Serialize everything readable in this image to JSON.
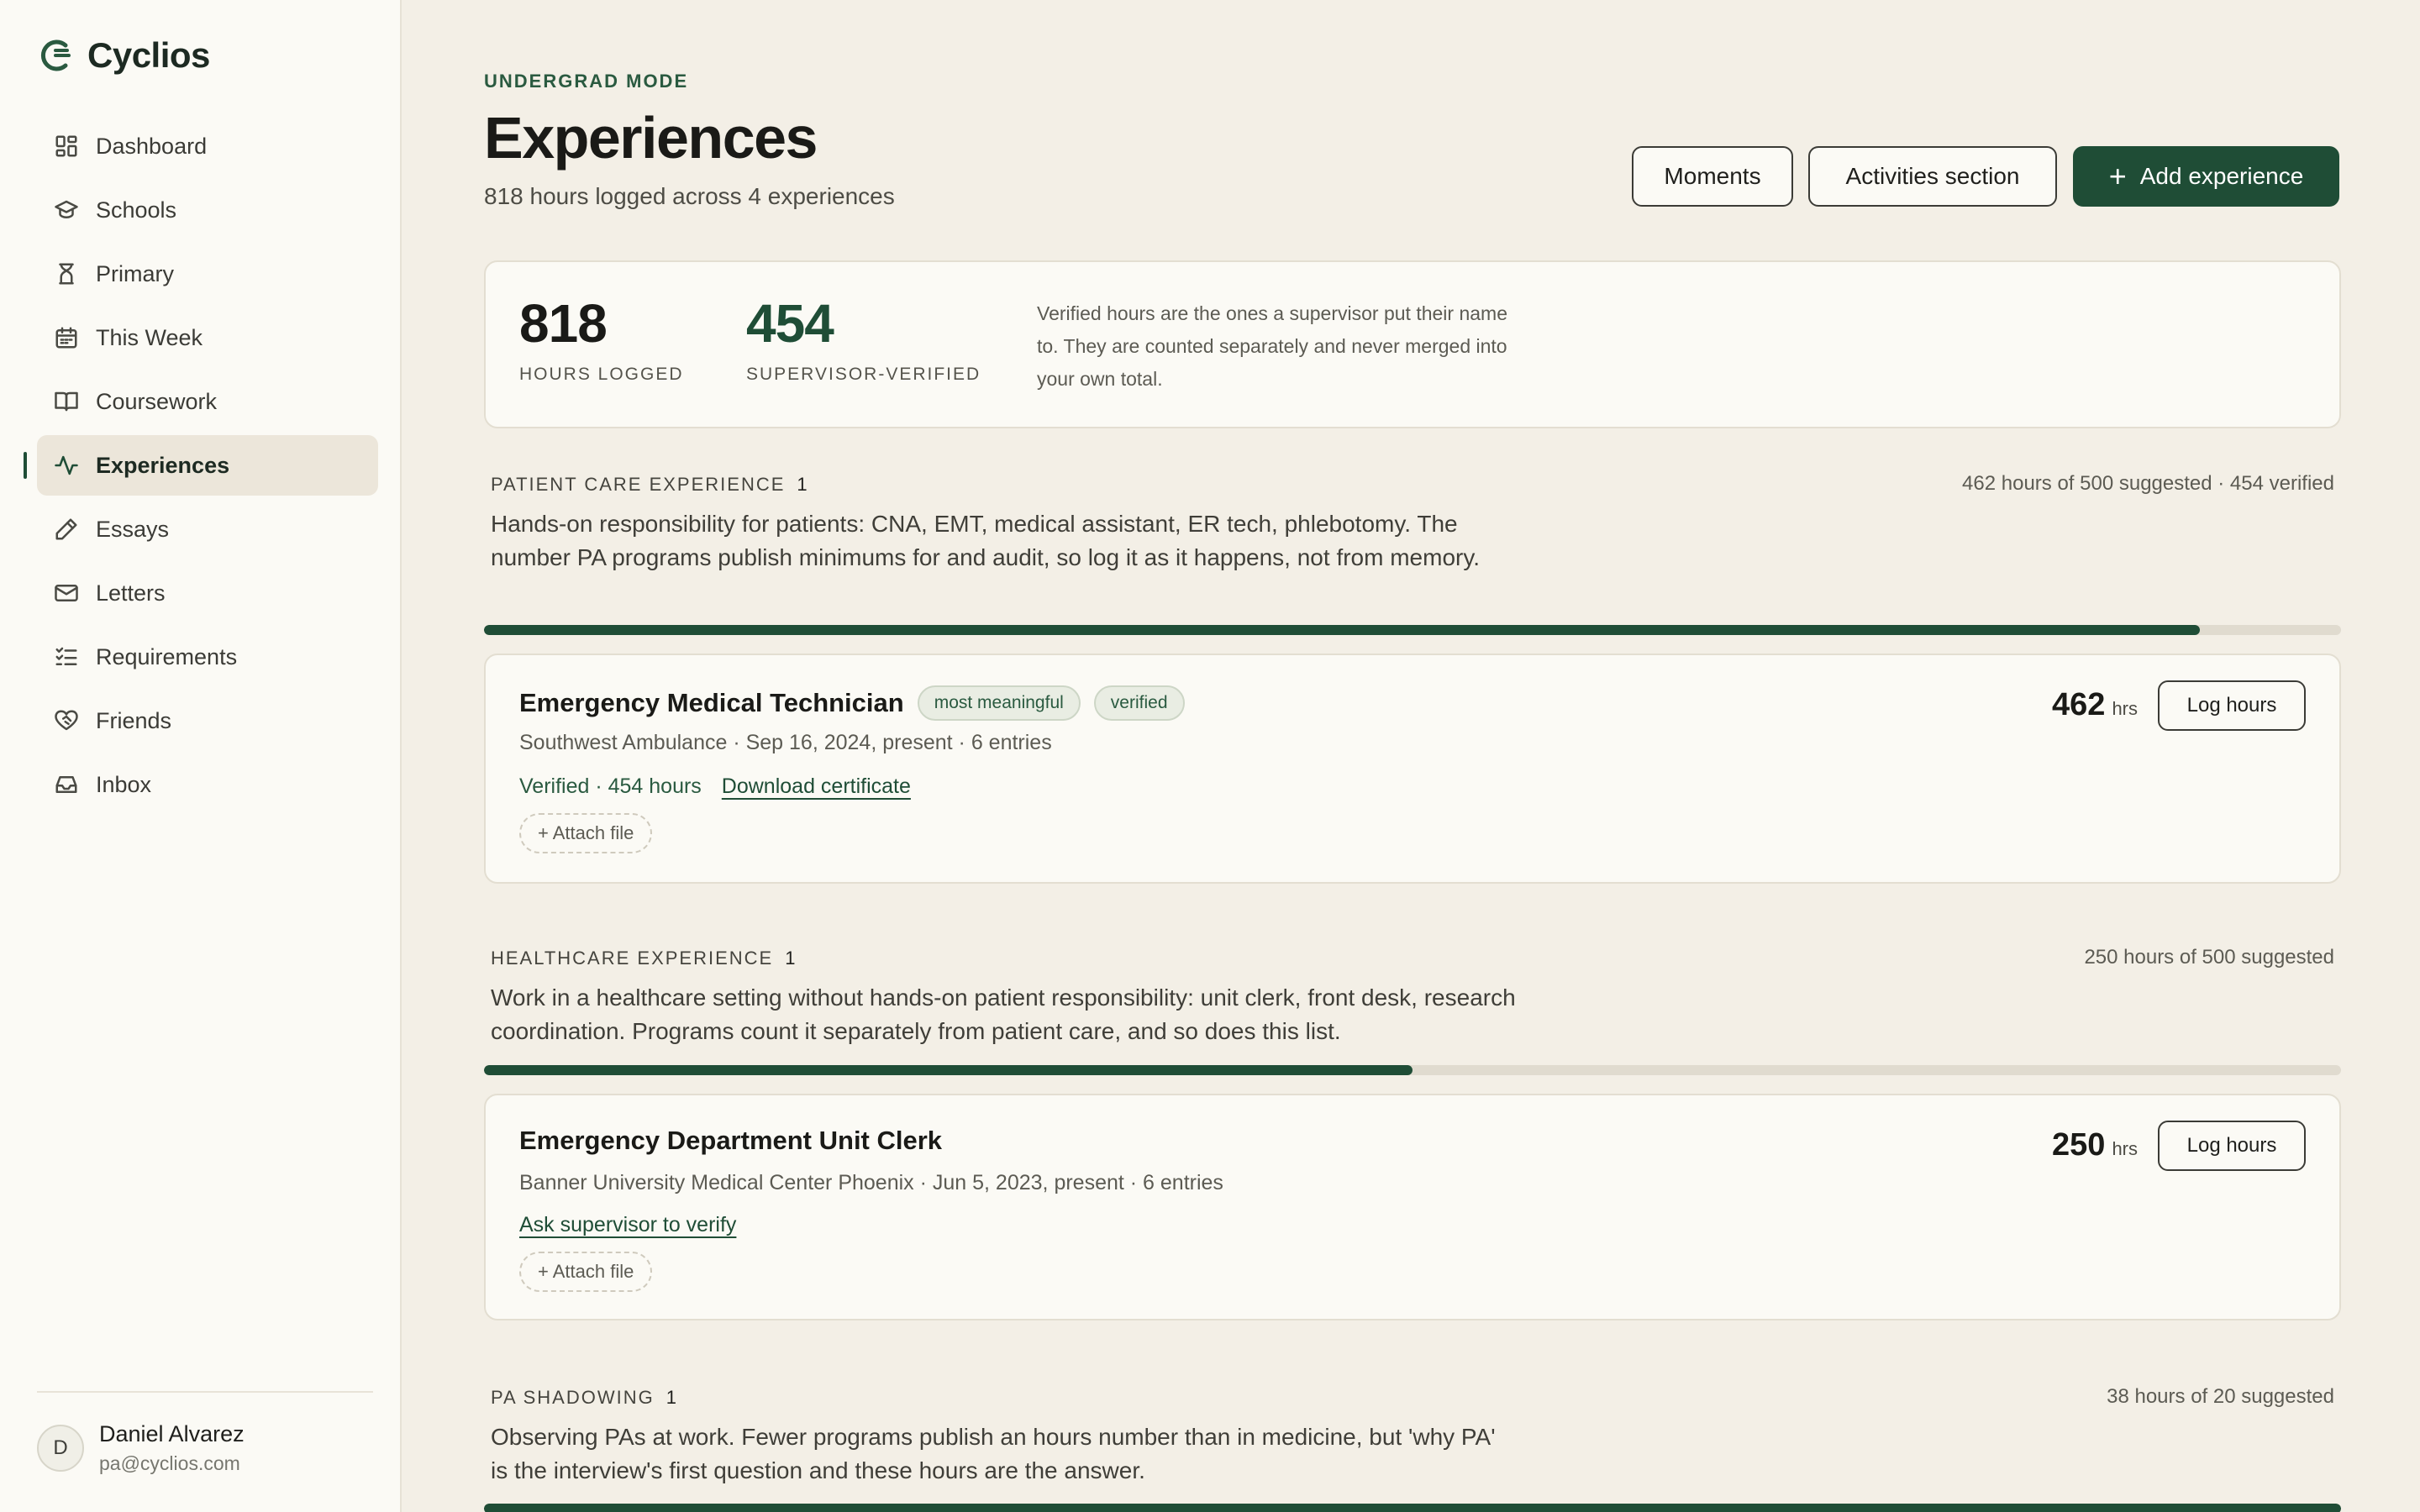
{
  "app": {
    "name": "Cyclios"
  },
  "sidebar": {
    "items": [
      {
        "label": "Dashboard",
        "icon": "grid-icon"
      },
      {
        "label": "Schools",
        "icon": "graduation-cap-icon"
      },
      {
        "label": "Primary",
        "icon": "hourglass-icon"
      },
      {
        "label": "This Week",
        "icon": "calendar-icon"
      },
      {
        "label": "Coursework",
        "icon": "book-icon"
      },
      {
        "label": "Experiences",
        "icon": "activity-icon",
        "active": true
      },
      {
        "label": "Essays",
        "icon": "pen-icon"
      },
      {
        "label": "Letters",
        "icon": "mail-icon"
      },
      {
        "label": "Requirements",
        "icon": "checklist-icon"
      },
      {
        "label": "Friends",
        "icon": "heart-handshake-icon"
      },
      {
        "label": "Inbox",
        "icon": "inbox-icon"
      }
    ]
  },
  "user": {
    "initial": "D",
    "name": "Daniel Alvarez",
    "email": "pa@cyclios.com"
  },
  "header": {
    "mode": "UNDERGRAD MODE",
    "title": "Experiences",
    "subtitle": "818 hours logged across 4 experiences",
    "buttons": {
      "moments": "Moments",
      "activities": "Activities section",
      "add": "Add experience"
    }
  },
  "stats": {
    "logged_value": "818",
    "logged_label": "HOURS LOGGED",
    "verified_value": "454",
    "verified_label": "SUPERVISOR-VERIFIED",
    "note": "Verified hours are the ones a supervisor put their name to. They are counted separately and never merged into your own total."
  },
  "sections": [
    {
      "heading": "PATIENT CARE EXPERIENCE",
      "count": "1",
      "meta": "462 hours of 500 suggested · 454 verified",
      "description": "Hands-on responsibility for patients: CNA, EMT, medical assistant, ER tech, phlebotomy. The number PA programs publish minimums for and audit, so log it as it happens, not from memory.",
      "progress": 0.924,
      "card": {
        "title": "Emergency Medical Technician",
        "tags": [
          "most meaningful",
          "verified"
        ],
        "subtitle": "Southwest Ambulance · Sep 16, 2024, present · 6 entries",
        "verified_text": "Verified · 454 hours",
        "link": "Download certificate",
        "attach": "+ Attach file",
        "hours": "462",
        "hours_unit": "hrs",
        "log_label": "Log hours"
      }
    },
    {
      "heading": "HEALTHCARE EXPERIENCE",
      "count": "1",
      "meta": "250 hours of 500 suggested",
      "description": "Work in a healthcare setting without hands-on patient responsibility: unit clerk, front desk, research coordination. Programs count it separately from patient care, and so does this list.",
      "progress": 0.5,
      "card": {
        "title": "Emergency Department Unit Clerk",
        "subtitle": "Banner University Medical Center Phoenix · Jun 5, 2023, present · 6 entries",
        "link": "Ask supervisor to verify",
        "attach": "+ Attach file",
        "hours": "250",
        "hours_unit": "hrs",
        "log_label": "Log hours"
      }
    },
    {
      "heading": "PA SHADOWING",
      "count": "1",
      "meta": "38 hours of 20 suggested",
      "description": "Observing PAs at work. Fewer programs publish an hours number than in medicine, but 'why PA' is the interview's first question and these hours are the answer.",
      "progress": 1.0
    }
  ],
  "colors": {
    "accent": "#1f4d36",
    "background": "#f3efe6",
    "sidebar": "#fbfaf5"
  }
}
